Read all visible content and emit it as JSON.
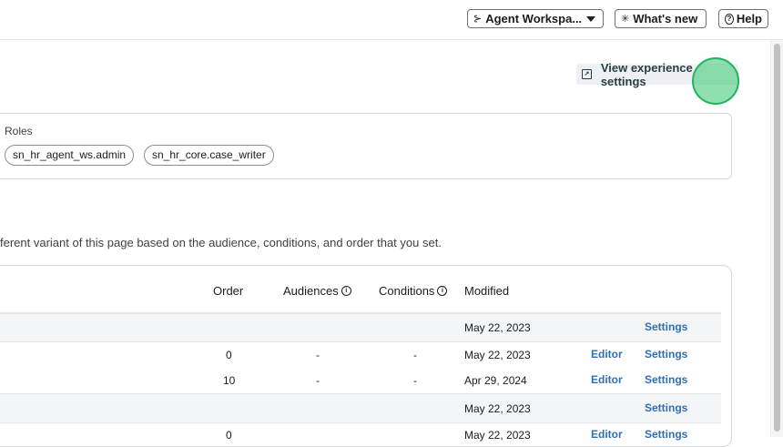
{
  "topbar": {
    "workspace_label": "Agent Workspa...",
    "whats_new_label": "What's new",
    "help_label": "Help"
  },
  "experience": {
    "settings_link": "View experience settings"
  },
  "roles": {
    "label": "Roles",
    "items": [
      "sn_hr_agent_ws.admin",
      "sn_hr_core.case_writer"
    ]
  },
  "variants": {
    "description": "ferent variant of this page based on the audience, conditions, and order that you set.",
    "columns": {
      "order": "Order",
      "audiences": "Audiences",
      "conditions": "Conditions",
      "modified": "Modified"
    },
    "rows": [
      {
        "group": true,
        "order": "",
        "audiences": "",
        "conditions": "",
        "modified": "May 22, 2023",
        "editor": "",
        "settings": "Settings"
      },
      {
        "group": false,
        "order": "0",
        "audiences": "-",
        "conditions": "-",
        "modified": "May 22, 2023",
        "editor": "Editor",
        "settings": "Settings"
      },
      {
        "group": false,
        "order": "10",
        "audiences": "-",
        "conditions": "-",
        "modified": "Apr 29, 2024",
        "editor": "Editor",
        "settings": "Settings"
      },
      {
        "group": true,
        "order": "",
        "audiences": "",
        "conditions": "",
        "modified": "May 22, 2023",
        "editor": "",
        "settings": "Settings"
      },
      {
        "group": false,
        "order": "0",
        "audiences": "-",
        "conditions": "-",
        "modified": "May 22, 2023",
        "editor": "Editor",
        "settings": "Settings"
      }
    ]
  },
  "colors": {
    "link": "#2f6fb3",
    "accent_cursor": "#22b35e"
  }
}
